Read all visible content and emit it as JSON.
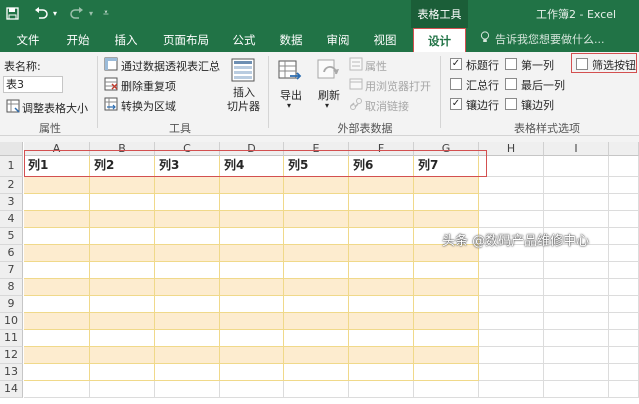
{
  "titlebar": {
    "quick_access": [
      "save-icon",
      "undo-icon",
      "redo-icon",
      "customize-icon"
    ],
    "context_tab_title": "表格工具",
    "doc_title": "工作簿2 - Excel"
  },
  "tabs": [
    {
      "label": "文件"
    },
    {
      "label": "开始"
    },
    {
      "label": "插入"
    },
    {
      "label": "页面布局"
    },
    {
      "label": "公式"
    },
    {
      "label": "数据"
    },
    {
      "label": "审阅"
    },
    {
      "label": "视图"
    },
    {
      "label": "设计",
      "active": true
    }
  ],
  "tellme": "告诉我您想要做什么...",
  "ribbon": {
    "properties": {
      "table_name_label": "表名称:",
      "table_name_value": "表3",
      "resize_label": "调整表格大小",
      "group_label": "属性"
    },
    "tools": {
      "pivot": "通过数据透视表汇总",
      "remove_dup": "删除重复项",
      "convert": "转换为区域",
      "slicer_line1": "插入",
      "slicer_line2": "切片器",
      "group_label": "工具"
    },
    "external": {
      "export": "导出",
      "refresh": "刷新",
      "props": "属性",
      "open_browser": "用浏览器打开",
      "unlink": "取消链接",
      "group_label": "外部表数据"
    },
    "style_options": {
      "header_row": {
        "label": "标题行",
        "checked": true
      },
      "total_row": {
        "label": "汇总行",
        "checked": false
      },
      "banded_rows": {
        "label": "镶边行",
        "checked": true
      },
      "first_col": {
        "label": "第一列",
        "checked": false
      },
      "last_col": {
        "label": "最后一列",
        "checked": false
      },
      "banded_cols": {
        "label": "镶边列",
        "checked": false
      },
      "filter_button": {
        "label": "筛选按钮",
        "checked": false
      },
      "group_label": "表格样式选项"
    }
  },
  "sheet": {
    "columns": [
      "A",
      "B",
      "C",
      "D",
      "E",
      "F",
      "G",
      "H",
      "I"
    ],
    "rows": [
      "1",
      "2",
      "3",
      "4",
      "5",
      "6",
      "7",
      "8",
      "9",
      "10",
      "11",
      "12",
      "13",
      "14"
    ],
    "table_headers": [
      "列1",
      "列2",
      "列3",
      "列4",
      "列5",
      "列6",
      "列7"
    ]
  },
  "watermark": "头条 @数码产品维修中心",
  "colors": {
    "excel_green": "#217346",
    "table_band": "#fdeccf",
    "table_border": "#f0d98a",
    "highlight": "#d35050"
  }
}
